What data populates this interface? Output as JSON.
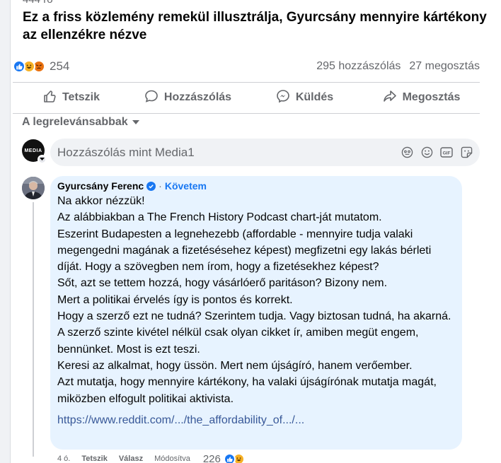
{
  "post": {
    "cut_text": "444 ró",
    "title": "Ez a friss közlemény remekül illusztrálja, Gyurcsány mennyire kártékony az ellenzékre nézve",
    "reaction_count": "254",
    "comments_count": "295 hozzászólás",
    "shares_count": "27 megosztás"
  },
  "actions": {
    "like": "Tetszik",
    "comment": "Hozzászólás",
    "send": "Küldés",
    "share": "Megosztás"
  },
  "sort_label": "A legrelevánsabbak",
  "composer": {
    "avatar_text": "MEDIA",
    "placeholder": "Hozzászólás mint Media1"
  },
  "comment": {
    "author": "Gyurcsány Ferenc",
    "follow_label": "Követem",
    "lines": [
      "Na akkor nézzük!",
      "Az alábbiakban a The French History Podcast chart-ját mutatom.",
      "Eszerint Budapesten a legnehezebb (affordable - mennyire tudja valaki megengedni magának a fizetésésehez képest) megfizetni egy lakás bérleti díját. Hogy a szövegben nem írom, hogy a fizetésekhez képest?",
      "Sőt, azt se tettem hozzá, hogy vásárlóerő paritáson? Bizony nem.",
      "Mert a politikai érvelés így is pontos és korrekt.",
      "Hogy a szerző ezt ne tudná? Szerintem tudja. Vagy biztosan tudná, ha akarná.",
      "A szerző szinte kivétel nélkül csak olyan cikket ír, amiben megüt engem, bennünket. Most is ezt teszi.",
      "Keresi az alkalmat, hogy üssön. Mert nem újságíró, hanem verőember.",
      "Azt mutatja, hogy mennyire kártékony, ha valaki újságírónak mutatja magát, miközben elfogult politikai aktivista."
    ],
    "link": "https://www.reddit.com/.../the_affordability_of.../...",
    "time": "4 ó.",
    "like_label": "Tetszik",
    "reply_label": "Válasz",
    "edited_label": "Módosítva",
    "reaction_count": "226"
  },
  "colors": {
    "accent": "#1877f2",
    "bubble": "#e7f3ff",
    "link": "#385898"
  }
}
